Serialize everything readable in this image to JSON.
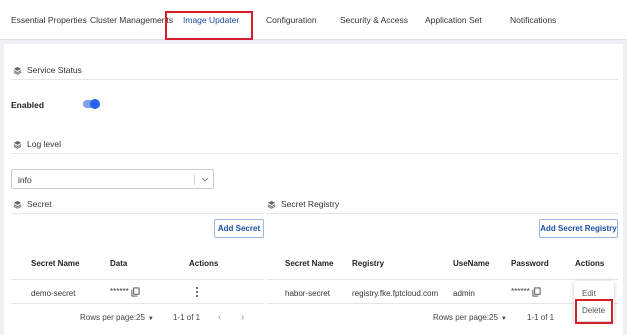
{
  "tabs": [
    {
      "label": "Essential Properties"
    },
    {
      "label": "Cluster Managements"
    },
    {
      "label": "Image Updater"
    },
    {
      "label": "Configuration"
    },
    {
      "label": "Security & Access"
    },
    {
      "label": "Application Set"
    },
    {
      "label": "Notifications"
    }
  ],
  "service_status": {
    "title": "Service Status",
    "enabled_label": "Enabled",
    "enabled": true
  },
  "log_level": {
    "title": "Log level",
    "value": "info"
  },
  "secret": {
    "title": "Secret",
    "add_button": "Add Secret",
    "columns": [
      "Secret Name",
      "Data",
      "Actions"
    ],
    "rows": [
      {
        "name": "demo-secret",
        "data": "******"
      }
    ],
    "pager": {
      "rows_per_page_label": "Rows per page:",
      "rows_per_page": "25",
      "range": "1-1 of 1"
    }
  },
  "secret_registry": {
    "title": "Secret Registry",
    "add_button": "Add Secret Registry",
    "columns": [
      "Secret Name",
      "Registry",
      "UseName",
      "Password",
      "Actions"
    ],
    "rows": [
      {
        "name": "habor-secret",
        "registry": "registry.fke.fptcloud.com",
        "username": "admin",
        "password": "******"
      }
    ],
    "pager": {
      "rows_per_page_label": "Rows per page:",
      "rows_per_page": "25",
      "range": "1-1 of 1"
    }
  },
  "action_menu": {
    "edit": "Edit",
    "delete": "Delete"
  },
  "colors": {
    "accent": "#1d4fa3",
    "highlight": "#d21f2b",
    "toggle": "#2563eb"
  },
  "icons": [
    "layers-icon",
    "copy-icon",
    "chevron-down-icon",
    "kebab-icon",
    "chevron-left-icon",
    "chevron-right-icon"
  ]
}
